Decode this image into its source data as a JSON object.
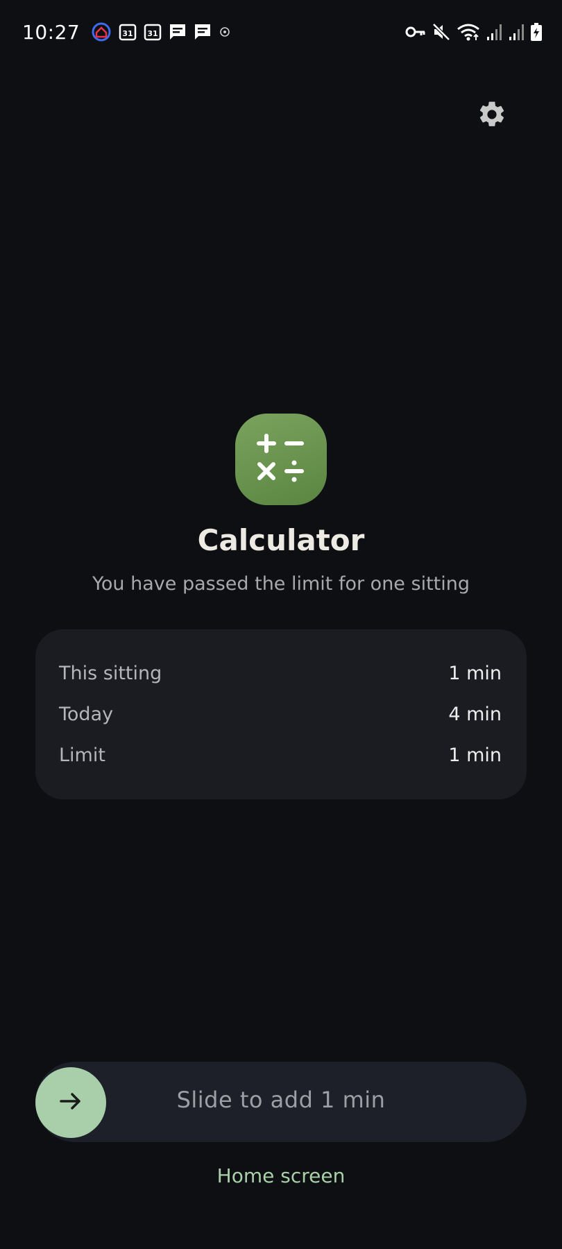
{
  "status_bar": {
    "time": "10:27",
    "calendar_day_1": "31",
    "calendar_day_2": "31",
    "icons_left": [
      "home-security-icon",
      "calendar-icon",
      "calendar-icon",
      "message-icon",
      "message-icon",
      "dot-icon"
    ],
    "icons_right": [
      "vpn-key-icon",
      "mute-icon",
      "wifi-icon",
      "signal-icon",
      "signal-icon",
      "battery-charging-icon"
    ]
  },
  "app": {
    "name": "Calculator",
    "message": "You have passed the limit for one sitting",
    "icon": "calculator-icon",
    "icon_color": "#6b9550"
  },
  "usage": {
    "rows": [
      {
        "label": "This sitting",
        "value": "1 min"
      },
      {
        "label": "Today",
        "value": "4 min"
      },
      {
        "label": "Limit",
        "value": "1 min"
      }
    ]
  },
  "slider": {
    "label": "Slide to add 1 min",
    "thumb_icon": "arrow-right-icon",
    "thumb_color": "#a8cfaa"
  },
  "home_link": "Home screen",
  "accent_color": "#a8d1a8"
}
